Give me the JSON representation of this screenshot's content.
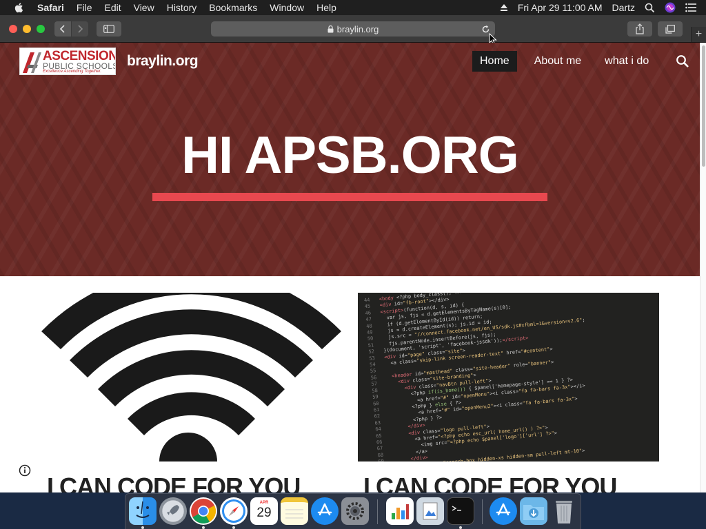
{
  "menubar": {
    "app_name": "Safari",
    "menus": [
      "File",
      "Edit",
      "View",
      "History",
      "Bookmarks",
      "Window",
      "Help"
    ],
    "datetime": "Fri Apr 29  11:00 AM",
    "user": "Dartz"
  },
  "browser": {
    "url": "braylin.org"
  },
  "site": {
    "logo_name": "ASCENSION",
    "logo_sub": "PUBLIC SCHOOLS",
    "logo_tagline": "Excellence Ascending Together.",
    "title": "braylin.org",
    "nav": [
      "Home",
      "About me",
      "what i do"
    ],
    "hero_title": "HI APSB.ORG",
    "posts": [
      {
        "title": "I CAN CODE FOR YOU"
      },
      {
        "title": "I CAN CODE FOR YOU"
      }
    ]
  },
  "dock": {
    "apps": [
      "Finder",
      "Launchpad",
      "Chrome",
      "Safari",
      "Calendar",
      "Notes",
      "App Store",
      "System Preferences",
      "Numbers",
      "Preview",
      "Terminal",
      "App Store",
      "Downloads",
      "Trash"
    ],
    "calendar_month": "APR",
    "calendar_day": "29"
  },
  "colors": {
    "hero_bg": "#6b2a26",
    "hero_rule": "#e8484f",
    "nav_active_bg": "#1c1c1c"
  }
}
